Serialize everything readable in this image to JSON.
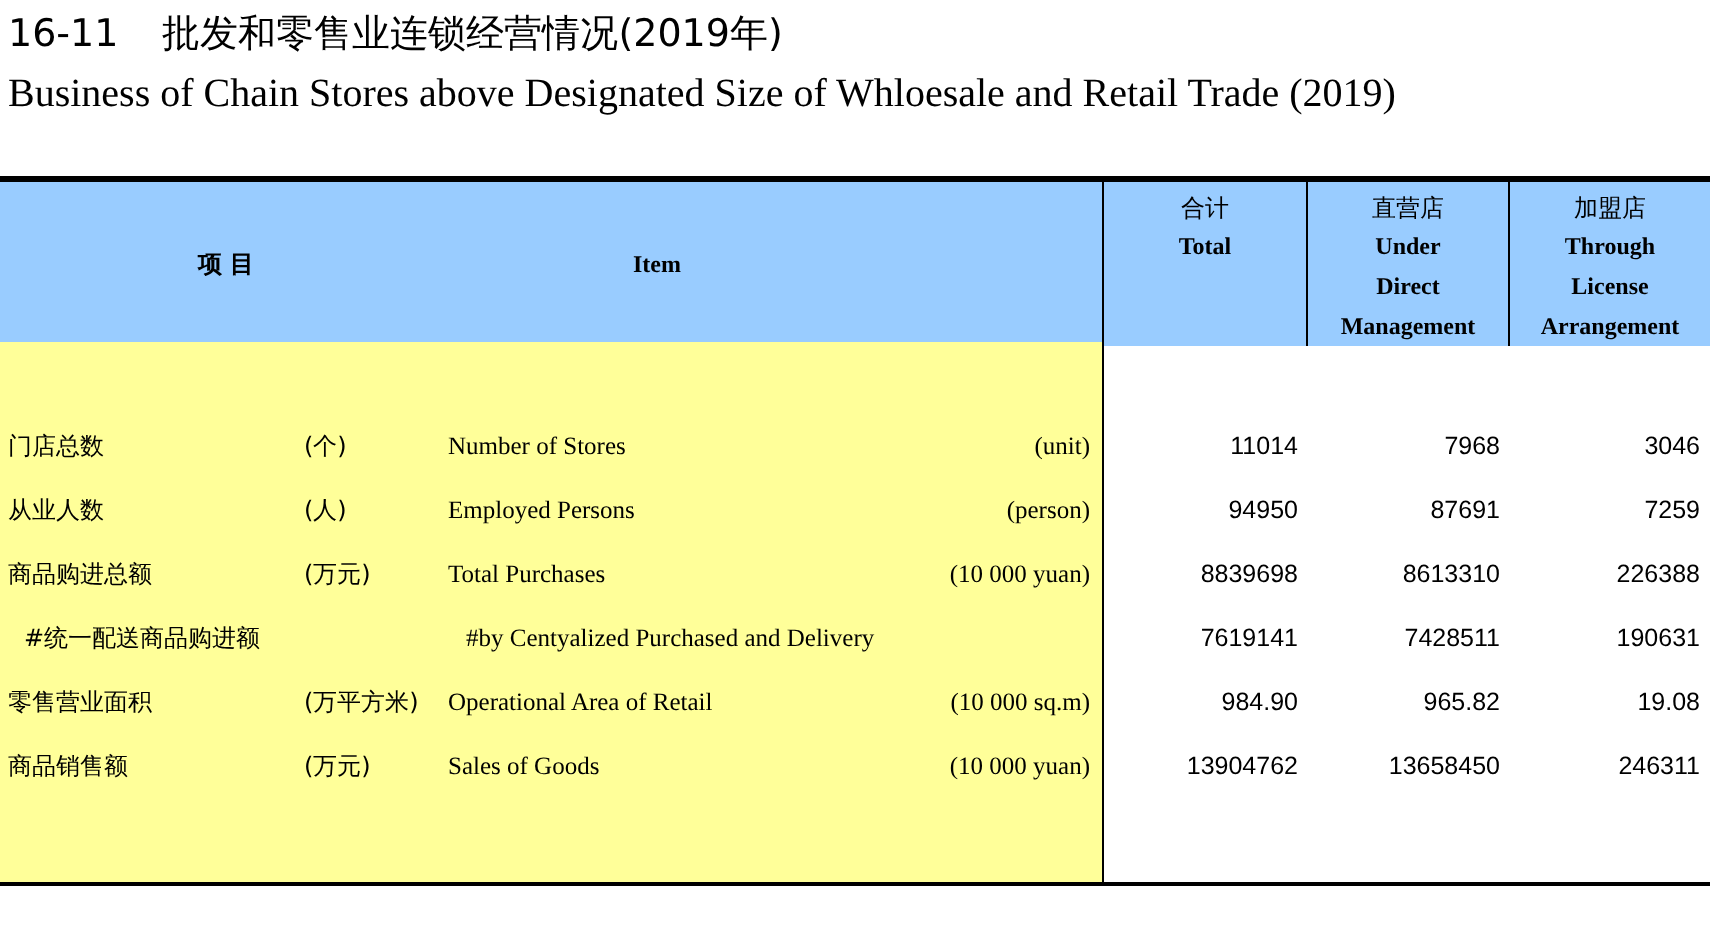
{
  "title": {
    "number": "16-11",
    "text": "批发和零售业连锁经营情况(2019年)",
    "subtitle": "Business of Chain Stores above Designated Size of Whloesale and Retail Trade (2019)"
  },
  "header": {
    "item_cn": "项  目",
    "item_en": "Item",
    "columns": [
      {
        "cn": "合计",
        "en": [
          "Total"
        ]
      },
      {
        "cn": "直营店",
        "en": [
          "Under",
          "Direct",
          "Management"
        ]
      },
      {
        "cn": "加盟店",
        "en": [
          "Through",
          "License",
          "Arrangement"
        ]
      }
    ]
  },
  "rows": [
    {
      "kind": "main",
      "cn": "门店总数",
      "cn_unit": "(个)",
      "en": "Number of Stores",
      "en_unit": "(unit)",
      "values": [
        "11014",
        "7968",
        "3046"
      ]
    },
    {
      "kind": "main",
      "cn": "从业人数",
      "cn_unit": "(人)",
      "en": "Employed Persons",
      "en_unit": "(person)",
      "values": [
        "94950",
        "87691",
        "7259"
      ]
    },
    {
      "kind": "main",
      "cn": "商品购进总额",
      "cn_unit": "(万元)",
      "en": "Total Purchases",
      "en_unit": "(10 000 yuan)",
      "values": [
        "8839698",
        "8613310",
        "226388"
      ]
    },
    {
      "kind": "sub",
      "cn": "#统一配送商品购进额",
      "en": "#by Centyalized Purchased and Delivery",
      "values": [
        "7619141",
        "7428511",
        "190631"
      ]
    },
    {
      "kind": "main",
      "cn": "零售营业面积",
      "cn_unit": "(万平方米)",
      "en": "Operational Area of Retail",
      "en_unit": "(10 000 sq.m)",
      "values": [
        "984.90",
        "965.82",
        "19.08"
      ]
    },
    {
      "kind": "main",
      "cn": "商品销售额",
      "cn_unit": "(万元)",
      "en": "Sales of Goods",
      "en_unit": "(10 000 yuan)",
      "values": [
        "13904762",
        "13658450",
        "246311"
      ]
    }
  ]
}
